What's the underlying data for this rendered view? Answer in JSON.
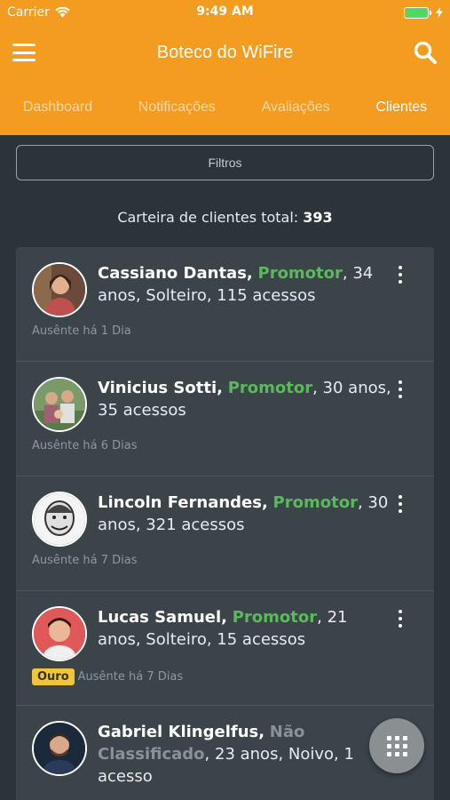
{
  "status": {
    "carrier": "Carrier",
    "time": "9:49 AM"
  },
  "header": {
    "title": "Boteco do WiFire"
  },
  "tabs": [
    {
      "label": "Dashboard"
    },
    {
      "label": "Notificações"
    },
    {
      "label": "Avaliações"
    },
    {
      "label": "Clientes"
    }
  ],
  "filter": {
    "label": "Filtros"
  },
  "total": {
    "label": "Carteira de clientes total:",
    "value": "393"
  },
  "clients": [
    {
      "name": "Cassiano Dantas,",
      "status": "Promotor",
      "details": ", 34 anos, Solteiro, 115 acessos",
      "absent": "Ausênte há 1 Dia",
      "badge": ""
    },
    {
      "name": "Vinicius Sotti,",
      "status": "Promotor",
      "details": ", 30 anos, 35 acessos",
      "absent": "Ausênte há 6 Dias",
      "badge": ""
    },
    {
      "name": "Lincoln Fernandes,",
      "status": "Promotor",
      "details": ", 30 anos, 321 acessos",
      "absent": "Ausênte há 7 Dias",
      "badge": ""
    },
    {
      "name": "Lucas Samuel,",
      "status": "Promotor",
      "details": ", 21 anos, Solteiro, 15 acessos",
      "absent": "Ausênte há 7 Dias",
      "badge": "Ouro"
    },
    {
      "name": "Gabriel Klingelfus,",
      "status": "Não Classificado",
      "details": ", 23 anos, Noivo, 1 acesso",
      "absent": "",
      "badge": ""
    }
  ],
  "colors": {
    "accent": "#f39c1f",
    "promotor": "#5cb85c",
    "background": "#2a3439",
    "card": "#3a4449",
    "badge": "#f0c53a"
  },
  "icons": {
    "menu": "hamburger-icon",
    "search": "search-icon",
    "more": "kebab-icon",
    "apps": "grid-icon"
  }
}
